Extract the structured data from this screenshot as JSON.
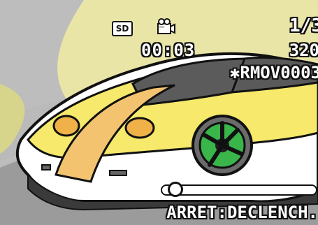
{
  "osd": {
    "storage_badge": "SD",
    "mode_icon": "movie-camera-icon",
    "elapsed_time": "00:03",
    "counter": "1/3",
    "remaining": "320",
    "filename": "✱RMOV0003",
    "hint": "ARRET:DECLENCH."
  },
  "playback": {
    "progress": 0.08
  }
}
